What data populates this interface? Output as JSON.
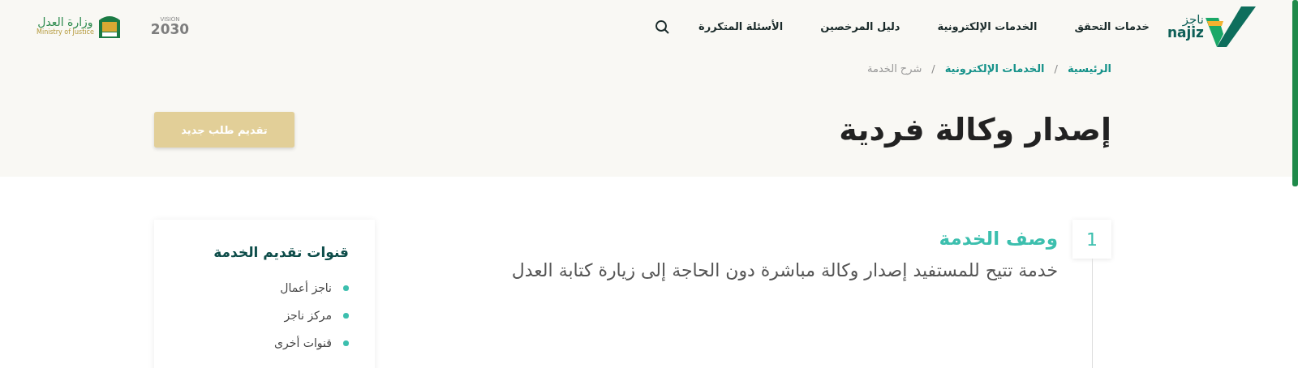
{
  "header": {
    "logo": {
      "arabic": "ناجز",
      "latin": "najiz"
    },
    "nav": [
      {
        "label": "خدمات التحقق"
      },
      {
        "label": "الخدمات الإلكترونية"
      },
      {
        "label": "دليل المرخصين"
      },
      {
        "label": "الأسئلة المتكررة"
      }
    ],
    "vision_logo": {
      "label": "VISION",
      "year": "2030"
    },
    "ministry_logo": {
      "arabic": "وزارة العدل",
      "english": "Ministry of Justice"
    }
  },
  "breadcrumb": {
    "separator": "/",
    "items": [
      {
        "label": "الرئيسية",
        "current": false
      },
      {
        "label": "الخدمات الإلكترونية",
        "current": false
      },
      {
        "label": "شرح الخدمة",
        "current": true
      }
    ]
  },
  "title": "إصدار وكالة فردية",
  "primary_button": "تقديم طلب جديد",
  "steps": [
    {
      "number": "1",
      "heading": "وصف الخدمة",
      "text": "خدمة تتيح للمستفيد إصدار وكالة مباشرة دون الحاجة إلى زيارة كتابة العدل"
    }
  ],
  "sidebar": {
    "title": "قنوات تقديم الخدمة",
    "items": [
      {
        "label": "ناجز أعمال"
      },
      {
        "label": "مركز ناجز"
      },
      {
        "label": "قنوات أخرى"
      }
    ]
  }
}
